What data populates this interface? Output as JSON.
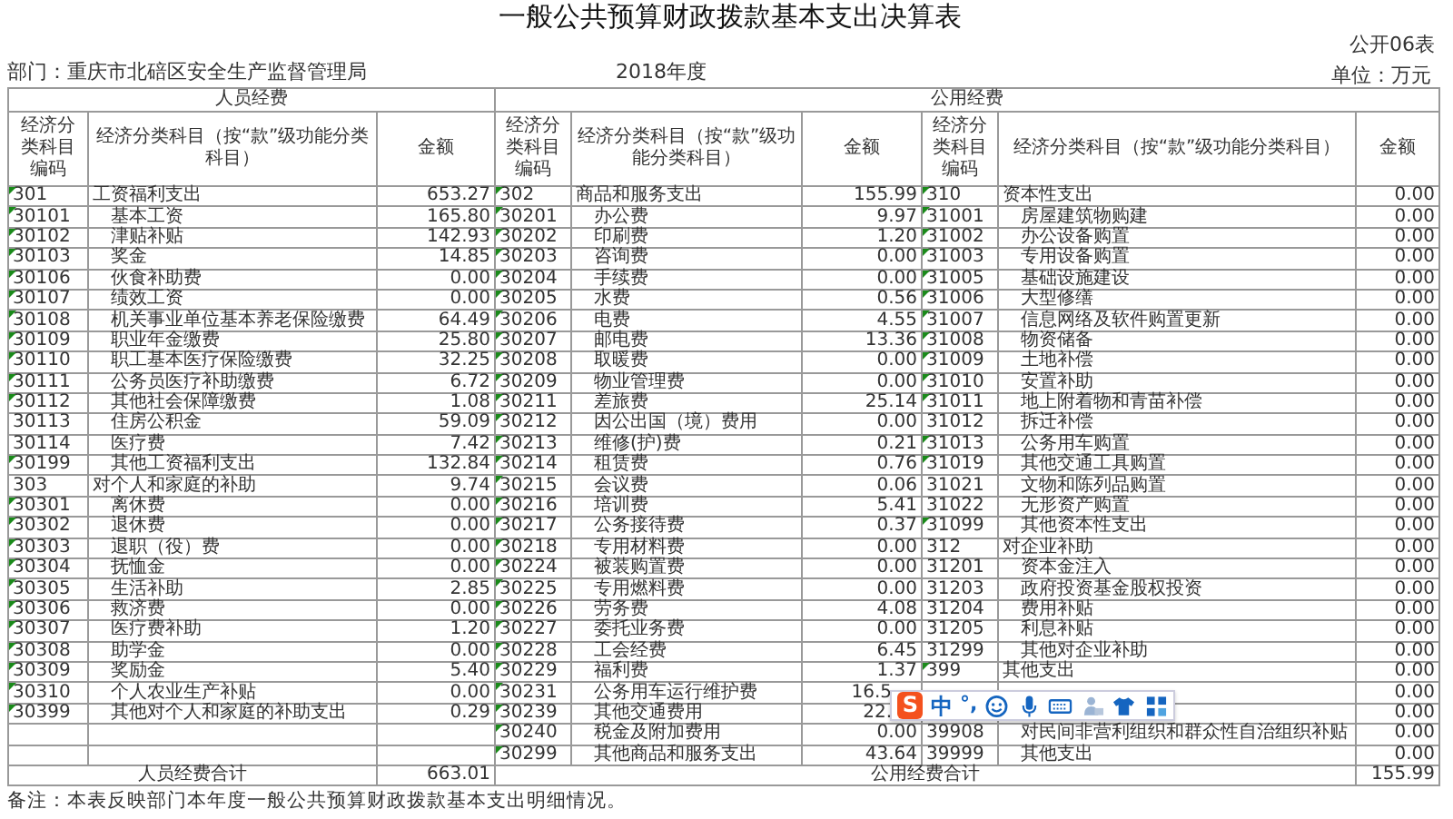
{
  "title": "一般公共预算财政拨款基本支出决算表",
  "form_no": "公开06表",
  "department": "部门：重庆市北碚区安全生产监督管理局",
  "year": "2018年度",
  "unit": "单位：万元",
  "sections": [
    {
      "group": "人员经费",
      "header": {
        "code": "经济分类科目编码",
        "name": "经济分类科目（按“款”级功能分类科目）",
        "amount": "金额"
      },
      "rows": [
        {
          "kind": "category",
          "code": "301",
          "name": "工资福利支出",
          "amount": "653.27",
          "marked": true
        },
        {
          "kind": "item",
          "code": "30101",
          "name": "基本工资",
          "amount": "165.80",
          "marked": true
        },
        {
          "kind": "item",
          "code": "30102",
          "name": "津贴补贴",
          "amount": "142.93",
          "marked": true
        },
        {
          "kind": "item",
          "code": "30103",
          "name": "奖金",
          "amount": "14.85",
          "marked": true
        },
        {
          "kind": "item",
          "code": "30106",
          "name": "伙食补助费",
          "amount": "0.00",
          "marked": true
        },
        {
          "kind": "item",
          "code": "30107",
          "name": "绩效工资",
          "amount": "0.00",
          "marked": true
        },
        {
          "kind": "item",
          "code": "30108",
          "name": "机关事业单位基本养老保险缴费",
          "amount": "64.49",
          "marked": true
        },
        {
          "kind": "item",
          "code": "30109",
          "name": "职业年金缴费",
          "amount": "25.80",
          "marked": true
        },
        {
          "kind": "item",
          "code": "30110",
          "name": "职工基本医疗保险缴费",
          "amount": "32.25",
          "marked": true
        },
        {
          "kind": "item",
          "code": "30111",
          "name": "公务员医疗补助缴费",
          "amount": "6.72",
          "marked": true
        },
        {
          "kind": "item",
          "code": "30112",
          "name": "其他社会保障缴费",
          "amount": "1.08",
          "marked": true
        },
        {
          "kind": "item",
          "code": "30113",
          "name": "住房公积金",
          "amount": "59.09",
          "marked": false
        },
        {
          "kind": "item",
          "code": "30114",
          "name": "医疗费",
          "amount": "7.42",
          "marked": false
        },
        {
          "kind": "item",
          "code": "30199",
          "name": "其他工资福利支出",
          "amount": "132.84",
          "marked": true
        },
        {
          "kind": "category",
          "code": "303",
          "name": "对个人和家庭的补助",
          "amount": "9.74",
          "marked": false
        },
        {
          "kind": "item",
          "code": "30301",
          "name": "离休费",
          "amount": "0.00",
          "marked": true
        },
        {
          "kind": "item",
          "code": "30302",
          "name": "退休费",
          "amount": "0.00",
          "marked": true
        },
        {
          "kind": "item",
          "code": "30303",
          "name": "退职（役）费",
          "amount": "0.00",
          "marked": true
        },
        {
          "kind": "item",
          "code": "30304",
          "name": "抚恤金",
          "amount": "0.00",
          "marked": true
        },
        {
          "kind": "item",
          "code": "30305",
          "name": "生活补助",
          "amount": "2.85",
          "marked": true
        },
        {
          "kind": "item",
          "code": "30306",
          "name": "救济费",
          "amount": "0.00",
          "marked": true
        },
        {
          "kind": "item",
          "code": "30307",
          "name": "医疗费补助",
          "amount": "1.20",
          "marked": true
        },
        {
          "kind": "item",
          "code": "30308",
          "name": "助学金",
          "amount": "0.00",
          "marked": true
        },
        {
          "kind": "item",
          "code": "30309",
          "name": "奖励金",
          "amount": "5.40",
          "marked": true
        },
        {
          "kind": "item",
          "code": "30310",
          "name": "个人农业生产补贴",
          "amount": "0.00",
          "marked": true
        },
        {
          "kind": "item",
          "code": "30399",
          "name": "其他对个人和家庭的补助支出",
          "amount": "0.29",
          "marked": true
        },
        {
          "kind": "blank"
        },
        {
          "kind": "blank"
        }
      ],
      "total": {
        "label": "人员经费合计",
        "amount": "663.01"
      }
    },
    {
      "group": "公用经费",
      "header": {
        "code": "经济分类科目编码",
        "name": "经济分类科目（按“款”级功能分类科目）",
        "amount": "金额"
      },
      "rows": [
        {
          "kind": "category",
          "code": "302",
          "name": "商品和服务支出",
          "amount": "155.99",
          "marked": true
        },
        {
          "kind": "item",
          "code": "30201",
          "name": "办公费",
          "amount": "9.97",
          "marked": true
        },
        {
          "kind": "item",
          "code": "30202",
          "name": "印刷费",
          "amount": "1.20",
          "marked": true
        },
        {
          "kind": "item",
          "code": "30203",
          "name": "咨询费",
          "amount": "0.00",
          "marked": true
        },
        {
          "kind": "item",
          "code": "30204",
          "name": "手续费",
          "amount": "0.00",
          "marked": true
        },
        {
          "kind": "item",
          "code": "30205",
          "name": "水费",
          "amount": "0.56",
          "marked": true
        },
        {
          "kind": "item",
          "code": "30206",
          "name": "电费",
          "amount": "4.55",
          "marked": true
        },
        {
          "kind": "item",
          "code": "30207",
          "name": "邮电费",
          "amount": "13.36",
          "marked": true
        },
        {
          "kind": "item",
          "code": "30208",
          "name": "取暖费",
          "amount": "0.00",
          "marked": true
        },
        {
          "kind": "item",
          "code": "30209",
          "name": "物业管理费",
          "amount": "0.00",
          "marked": true
        },
        {
          "kind": "item",
          "code": "30211",
          "name": "差旅费",
          "amount": "25.14",
          "marked": true
        },
        {
          "kind": "item",
          "code": "30212",
          "name": "因公出国（境）费用",
          "amount": "0.00",
          "marked": true
        },
        {
          "kind": "item",
          "code": "30213",
          "name": "维修(护)费",
          "amount": "0.21",
          "marked": true
        },
        {
          "kind": "item",
          "code": "30214",
          "name": "租赁费",
          "amount": "0.76",
          "marked": true
        },
        {
          "kind": "item",
          "code": "30215",
          "name": "会议费",
          "amount": "0.06",
          "marked": true
        },
        {
          "kind": "item",
          "code": "30216",
          "name": "培训费",
          "amount": "5.41",
          "marked": true
        },
        {
          "kind": "item",
          "code": "30217",
          "name": "公务接待费",
          "amount": "0.37",
          "marked": true
        },
        {
          "kind": "item",
          "code": "30218",
          "name": "专用材料费",
          "amount": "0.00",
          "marked": true
        },
        {
          "kind": "item",
          "code": "30224",
          "name": "被装购置费",
          "amount": "0.00",
          "marked": true
        },
        {
          "kind": "item",
          "code": "30225",
          "name": "专用燃料费",
          "amount": "0.00",
          "marked": true
        },
        {
          "kind": "item",
          "code": "30226",
          "name": "劳务费",
          "amount": "4.08",
          "marked": true
        },
        {
          "kind": "item",
          "code": "30227",
          "name": "委托业务费",
          "amount": "0.00",
          "marked": true
        },
        {
          "kind": "item",
          "code": "30228",
          "name": "工会经费",
          "amount": "6.45",
          "marked": true
        },
        {
          "kind": "item",
          "code": "30229",
          "name": "福利费",
          "amount": "1.37",
          "marked": true
        },
        {
          "kind": "covered",
          "code": "30231",
          "name": "公务用车运行维护费",
          "amount": "16.5",
          "marked": true
        },
        {
          "kind": "covered",
          "code": "30239",
          "name": "其他交通费用",
          "amount": "22.",
          "marked": true
        },
        {
          "kind": "item",
          "code": "30240",
          "name": "税金及附加费用",
          "amount": "0.00",
          "marked": true
        },
        {
          "kind": "item",
          "code": "30299",
          "name": "其他商品和服务支出",
          "amount": "43.64",
          "marked": true
        }
      ]
    },
    {
      "header": {
        "code": "经济分类科目编码",
        "name": "经济分类科目（按“款”级功能分类科目）",
        "amount": "金额"
      },
      "rows": [
        {
          "kind": "category",
          "code": "310",
          "name": "资本性支出",
          "amount": "0.00",
          "marked": true
        },
        {
          "kind": "item",
          "code": "31001",
          "name": "房屋建筑物购建",
          "amount": "0.00",
          "marked": true
        },
        {
          "kind": "item",
          "code": "31002",
          "name": "办公设备购置",
          "amount": "0.00",
          "marked": true
        },
        {
          "kind": "item",
          "code": "31003",
          "name": "专用设备购置",
          "amount": "0.00",
          "marked": true
        },
        {
          "kind": "item",
          "code": "31005",
          "name": "基础设施建设",
          "amount": "0.00",
          "marked": true
        },
        {
          "kind": "item",
          "code": "31006",
          "name": "大型修缮",
          "amount": "0.00",
          "marked": true
        },
        {
          "kind": "item",
          "code": "31007",
          "name": "信息网络及软件购置更新",
          "amount": "0.00",
          "marked": true
        },
        {
          "kind": "item",
          "code": "31008",
          "name": "物资储备",
          "amount": "0.00",
          "marked": true
        },
        {
          "kind": "item",
          "code": "31009",
          "name": "土地补偿",
          "amount": "0.00",
          "marked": true
        },
        {
          "kind": "item",
          "code": "31010",
          "name": "安置补助",
          "amount": "0.00",
          "marked": true
        },
        {
          "kind": "item",
          "code": "31011",
          "name": "地上附着物和青苗补偿",
          "amount": "0.00",
          "marked": true
        },
        {
          "kind": "item",
          "code": "31012",
          "name": "拆迁补偿",
          "amount": "0.00",
          "marked": false
        },
        {
          "kind": "item",
          "code": "31013",
          "name": "公务用车购置",
          "amount": "0.00",
          "marked": true
        },
        {
          "kind": "item",
          "code": "31019",
          "name": "其他交通工具购置",
          "amount": "0.00",
          "marked": true
        },
        {
          "kind": "item",
          "code": "31021",
          "name": "文物和陈列品购置",
          "amount": "0.00",
          "marked": false
        },
        {
          "kind": "item",
          "code": "31022",
          "name": "无形资产购置",
          "amount": "0.00",
          "marked": false
        },
        {
          "kind": "item",
          "code": "31099",
          "name": "其他资本性支出",
          "amount": "0.00",
          "marked": true
        },
        {
          "kind": "category",
          "code": "312",
          "name": "对企业补助",
          "amount": "0.00",
          "marked": false
        },
        {
          "kind": "item",
          "code": "31201",
          "name": "资本金注入",
          "amount": "0.00",
          "marked": false
        },
        {
          "kind": "item",
          "code": "31203",
          "name": "政府投资基金股权投资",
          "amount": "0.00",
          "marked": false
        },
        {
          "kind": "item",
          "code": "31204",
          "name": "费用补贴",
          "amount": "0.00",
          "marked": false
        },
        {
          "kind": "item",
          "code": "31205",
          "name": "利息补贴",
          "amount": "0.00",
          "marked": false
        },
        {
          "kind": "item",
          "code": "31299",
          "name": "其他对企业补助",
          "amount": "0.00",
          "marked": false
        },
        {
          "kind": "category",
          "code": "399",
          "name": "其他支出",
          "amount": "0.00",
          "marked": true
        },
        {
          "kind": "item",
          "amount": "0.00"
        },
        {
          "kind": "item",
          "amount": "0.00"
        },
        {
          "kind": "item",
          "code": "39908",
          "name": "对民间非营利组织和群众性自治组织补贴",
          "amount": "0.00",
          "marked": false
        },
        {
          "kind": "item",
          "code": "39999",
          "name": "其他支出",
          "amount": "0.00",
          "marked": false
        }
      ]
    }
  ],
  "public_total": {
    "label": "公用经费合计",
    "amount": "155.99"
  },
  "note": "备注：本表反映部门本年度一般公共预算财政拨款基本支出明细情况。",
  "ime_toolbar": {
    "logo": "S",
    "mode": "中",
    "punct": "°,"
  }
}
